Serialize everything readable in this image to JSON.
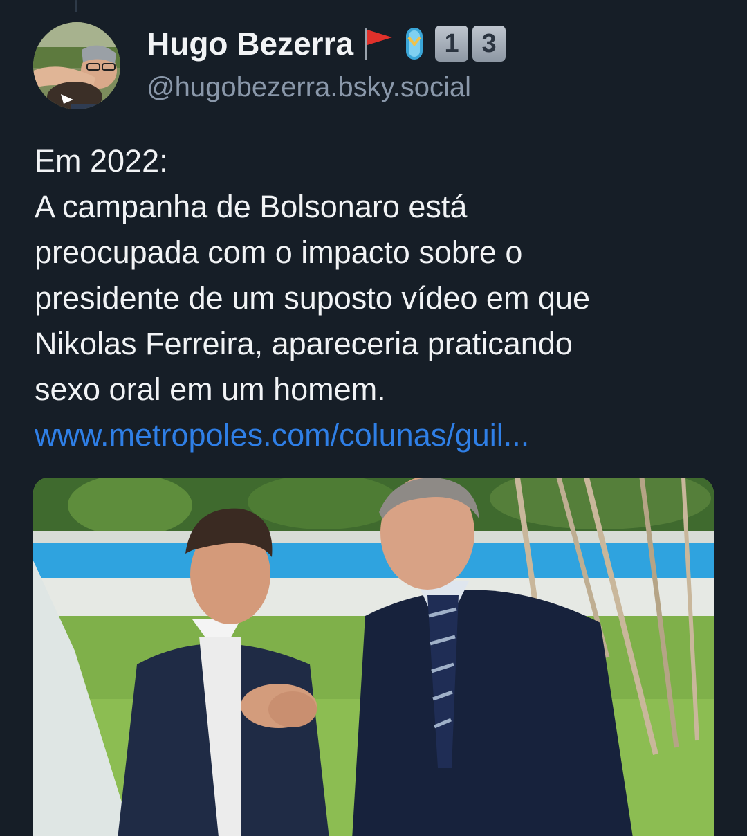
{
  "author": {
    "display_name": "Hugo Bezerra",
    "name_emoji": [
      "triangular-flag",
      "thong-sandal"
    ],
    "keycaps": [
      "1",
      "3"
    ],
    "handle": "@hugobezerra.bsky.social"
  },
  "post": {
    "lines": [
      "Em 2022:",
      "A campanha de Bolsonaro está",
      "preocupada com o impacto sobre o",
      "presidente de um suposto vídeo em que",
      "Nikolas Ferreira, apareceria praticando",
      "sexo oral em um homem."
    ],
    "link_text": "www.metropoles.com/colunas/guil..."
  },
  "colors": {
    "background": "#161e27",
    "text": "#f1f3f5",
    "handle": "#8a98aa",
    "link": "#2f7fe6"
  }
}
